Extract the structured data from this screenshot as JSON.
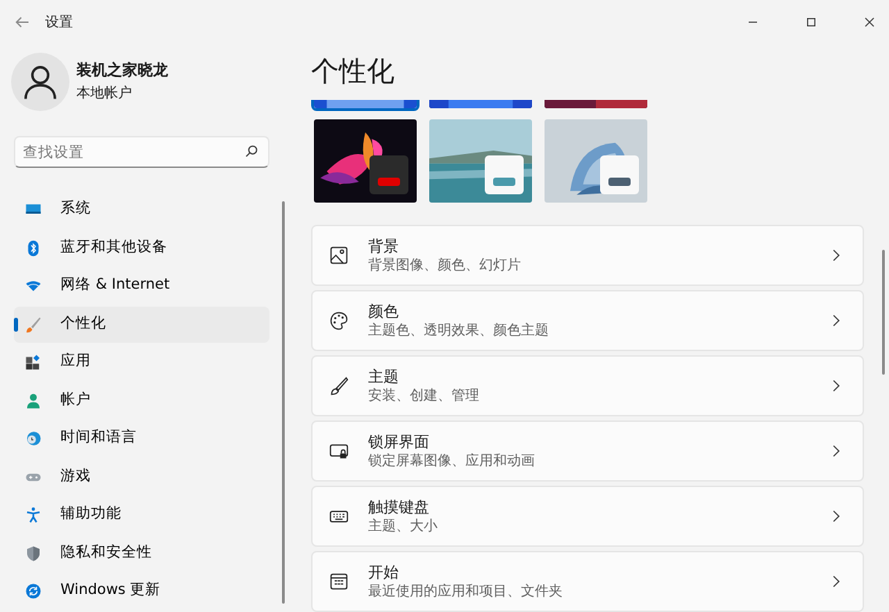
{
  "window": {
    "title": "设置"
  },
  "account": {
    "name": "装机之家晓龙",
    "type": "本地帐户"
  },
  "search": {
    "placeholder": "查找设置"
  },
  "nav": [
    {
      "label": "系统",
      "selected": false
    },
    {
      "label": "蓝牙和其他设备",
      "selected": false
    },
    {
      "label": "网络 & Internet",
      "selected": false
    },
    {
      "label": "个性化",
      "selected": true
    },
    {
      "label": "应用",
      "selected": false
    },
    {
      "label": "帐户",
      "selected": false
    },
    {
      "label": "时间和语言",
      "selected": false
    },
    {
      "label": "游戏",
      "selected": false
    },
    {
      "label": "辅助功能",
      "selected": false
    },
    {
      "label": "隐私和安全性",
      "selected": false
    },
    {
      "label": "Windows 更新",
      "selected": false
    }
  ],
  "page_title": "个性化",
  "themes": [
    {
      "kind": "picture",
      "selected": true
    },
    {
      "kind": "picture",
      "selected": false
    },
    {
      "kind": "picture",
      "selected": false
    },
    {
      "kind": "picture",
      "selected": false,
      "color": "#e00000"
    },
    {
      "kind": "picture",
      "selected": false,
      "color": "#4a9aab"
    },
    {
      "kind": "picture",
      "selected": false,
      "color": "#4c6072"
    }
  ],
  "settings": [
    {
      "title": "背景",
      "subtitle": "背景图像、颜色、幻灯片"
    },
    {
      "title": "颜色",
      "subtitle": "主题色、透明效果、颜色主题"
    },
    {
      "title": "主题",
      "subtitle": "安装、创建、管理"
    },
    {
      "title": "锁屏界面",
      "subtitle": "锁定屏幕图像、应用和动画"
    },
    {
      "title": "触摸键盘",
      "subtitle": "主题、大小"
    },
    {
      "title": "开始",
      "subtitle": "最近使用的应用和项目、文件夹"
    }
  ]
}
